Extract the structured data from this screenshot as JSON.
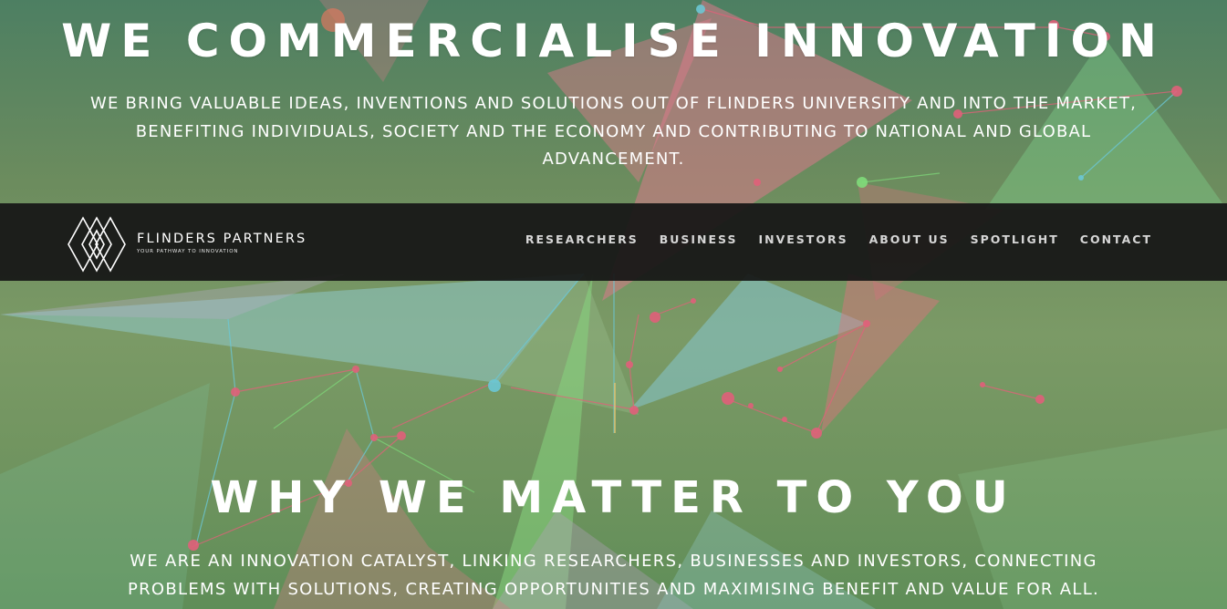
{
  "hero": {
    "title": "WE COMMERCIALISE INNOVATION",
    "subtitle": "WE BRING VALUABLE IDEAS, INVENTIONS AND SOLUTIONS OUT OF FLINDERS UNIVERSITY AND INTO THE MARKET, BENEFITING INDIVIDUALS, SOCIETY AND THE ECONOMY AND CONTRIBUTING TO NATIONAL AND GLOBAL ADVANCEMENT."
  },
  "brand": {
    "name": "FLINDERS PARTNERS",
    "tagline": "YOUR PATHWAY TO INNOVATION",
    "logo_icon": "diamond-lattice-logo"
  },
  "nav": {
    "items": [
      {
        "label": "RESEARCHERS"
      },
      {
        "label": "BUSINESS"
      },
      {
        "label": "INVESTORS"
      },
      {
        "label": "ABOUT US"
      },
      {
        "label": "SPOTLIGHT"
      },
      {
        "label": "CONTACT"
      }
    ]
  },
  "section": {
    "title": "WHY WE MATTER TO YOU",
    "body": "WE ARE AN INNOVATION CATALYST, LINKING RESEARCHERS, BUSINESSES AND INVESTORS, CONNECTING PROBLEMS WITH SOLUTIONS, CREATING OPPORTUNITIES AND MAXIMISING BENEFIT AND VALUE FOR ALL."
  },
  "colors": {
    "navbar_bg": "#161616",
    "text": "#ffffff",
    "nav_text": "#d6d6d6",
    "bg_green": "#6c8c5e",
    "accent_pink": "#e0607a",
    "accent_cyan": "#6ec6c8",
    "accent_lightgreen": "#7fd37a"
  }
}
